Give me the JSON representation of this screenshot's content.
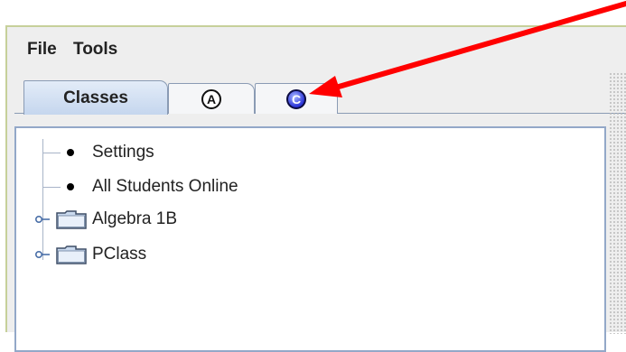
{
  "menu": {
    "items": [
      {
        "label": "File"
      },
      {
        "label": "Tools"
      }
    ]
  },
  "tabs": [
    {
      "label": "Classes",
      "selected": true
    },
    {
      "badge": "A",
      "icon": "circle-letter-a-icon"
    },
    {
      "badge": "C",
      "icon": "circle-letter-c-icon"
    }
  ],
  "tree": {
    "items": [
      {
        "label": "Settings",
        "type": "leaf"
      },
      {
        "label": "All Students Online",
        "type": "leaf"
      },
      {
        "label": "Algebra 1B",
        "type": "folder"
      },
      {
        "label": "PClass",
        "type": "folder"
      }
    ]
  },
  "annotation": {
    "color": "#ff0000"
  },
  "colors": {
    "window_border": "#c6d09a",
    "selected_tab": "#c5d6ee",
    "tree_border": "#93a8c8"
  }
}
